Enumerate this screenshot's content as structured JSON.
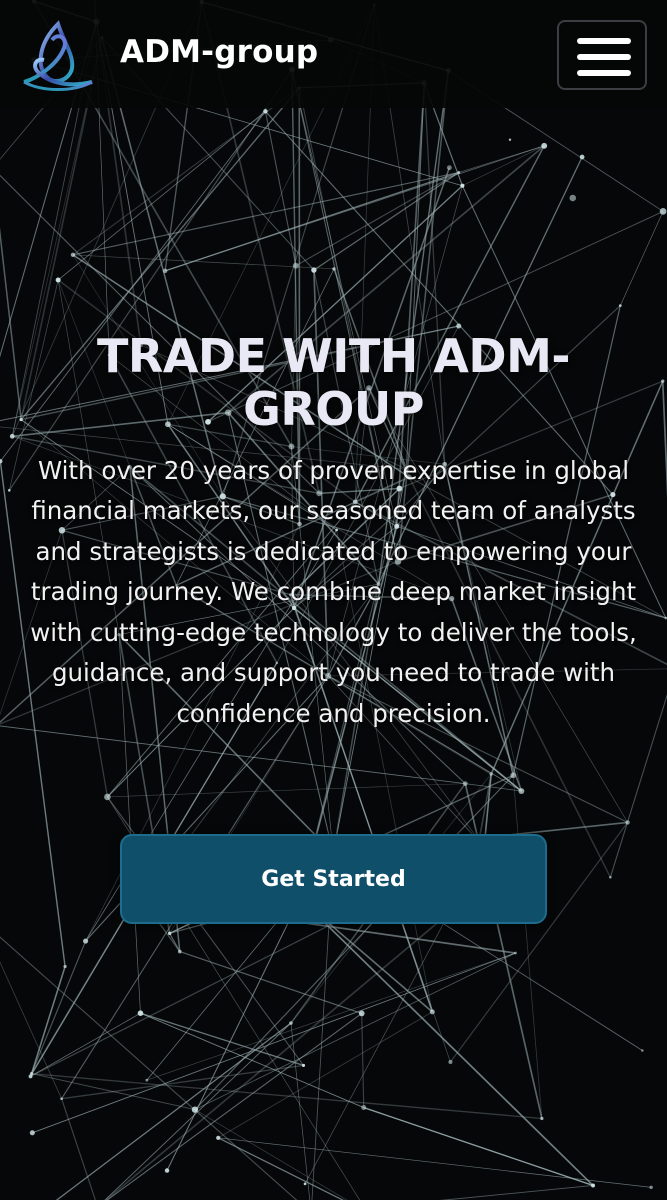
{
  "header": {
    "brand": "ADM-group",
    "logo_icon": "triquetra-logo-icon",
    "menu_icon": "hamburger-menu-icon"
  },
  "hero": {
    "title": "TRADE WITH ADM-GROUP",
    "description": "With over 20 years of proven expertise in global financial markets, our seasoned team of analysts and strategists is dedicated to empowering your trading journey. We combine deep market insight with cutting-edge technology to deliver the tools, guidance, and support you need to trade with confidence and precision.",
    "cta_label": "Get Started"
  },
  "colors": {
    "background": "#060708",
    "network_lines": "#9fb3b7",
    "cta_background": "#0f4f6a",
    "title_text": "#e9e9f5"
  }
}
